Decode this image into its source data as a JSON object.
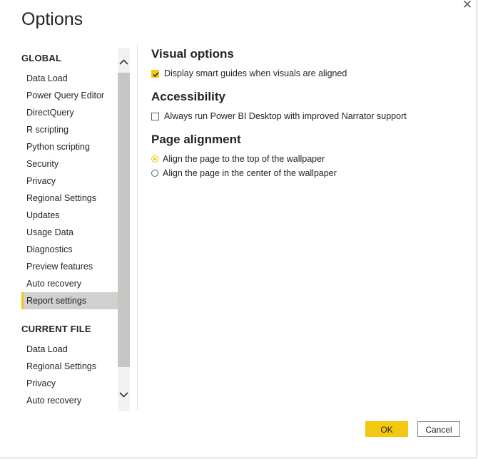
{
  "window": {
    "title": "Options",
    "close_glyph": "✕"
  },
  "sidebar": {
    "global_header": "GLOBAL",
    "global_items": [
      {
        "label": "Data Load"
      },
      {
        "label": "Power Query Editor"
      },
      {
        "label": "DirectQuery"
      },
      {
        "label": "R scripting"
      },
      {
        "label": "Python scripting"
      },
      {
        "label": "Security"
      },
      {
        "label": "Privacy"
      },
      {
        "label": "Regional Settings"
      },
      {
        "label": "Updates"
      },
      {
        "label": "Usage Data"
      },
      {
        "label": "Diagnostics"
      },
      {
        "label": "Preview features"
      },
      {
        "label": "Auto recovery"
      },
      {
        "label": "Report settings",
        "selected": true
      }
    ],
    "current_file_header": "CURRENT FILE",
    "current_file_items": [
      {
        "label": "Data Load"
      },
      {
        "label": "Regional Settings"
      },
      {
        "label": "Privacy"
      },
      {
        "label": "Auto recovery"
      }
    ],
    "scroll_up_icon": "chevron-up-icon",
    "scroll_down_icon": "chevron-down-icon"
  },
  "content": {
    "visual_options": {
      "title": "Visual options",
      "smart_guides": {
        "label": "Display smart guides when visuals are aligned",
        "checked": true
      }
    },
    "accessibility": {
      "title": "Accessibility",
      "narrator": {
        "label": "Always run Power BI Desktop with improved Narrator support",
        "checked": false
      }
    },
    "page_alignment": {
      "title": "Page alignment",
      "options": [
        {
          "label": "Align the page to the top of the wallpaper",
          "selected": true
        },
        {
          "label": "Align the page in the center of the wallpaper",
          "selected": false
        }
      ]
    }
  },
  "footer": {
    "ok_label": "OK",
    "cancel_label": "Cancel"
  },
  "colors": {
    "accent": "#f2c811",
    "selected_bg": "#d2d0ce",
    "text": "#252423"
  }
}
